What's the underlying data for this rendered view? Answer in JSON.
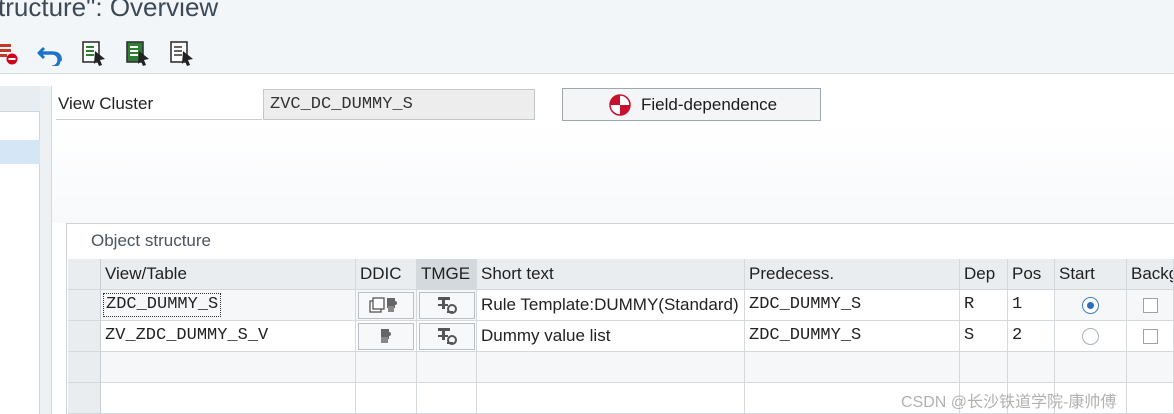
{
  "window": {
    "title": "tructure\": Overview"
  },
  "toolbar": {
    "buttons": [
      {
        "icon": "delete-entry-icon"
      },
      {
        "icon": "undo-icon"
      },
      {
        "icon": "select-all-icon"
      },
      {
        "icon": "select-block-icon"
      },
      {
        "icon": "deselect-all-icon"
      }
    ]
  },
  "header": {
    "view_cluster_label": "View Cluster",
    "view_cluster_value": "ZVC_DC_DUMMY_S",
    "field_dependence_label": "Field-dependence"
  },
  "object_structure": {
    "title": "Object structure",
    "columns": {
      "view_table": "View/Table",
      "ddic": "DDIC",
      "tmge": "TMGE",
      "short_text": "Short text",
      "predecessor": "Predecess.",
      "dep": "Dep",
      "pos": "Pos",
      "start": "Start",
      "background": "Backg"
    },
    "rows": [
      {
        "view_table": "ZDC_DUMMY_S",
        "short_text": "Rule Template:DUMMY(Standard)",
        "predecessor": "ZDC_DUMMY_S",
        "dep": "R",
        "pos": "1",
        "start_selected": true
      },
      {
        "view_table": "ZV_ZDC_DUMMY_S_V",
        "short_text": "Dummy value list",
        "predecessor": "ZDC_DUMMY_S",
        "dep": "S",
        "pos": "2",
        "start_selected": false
      }
    ]
  },
  "watermark": "CSDN @长沙铁道学院-康帅傅",
  "colors": {
    "accent": "#2a6fbe",
    "header_bg": "#e9edf0",
    "field_dependence_red": "#c8102e"
  }
}
